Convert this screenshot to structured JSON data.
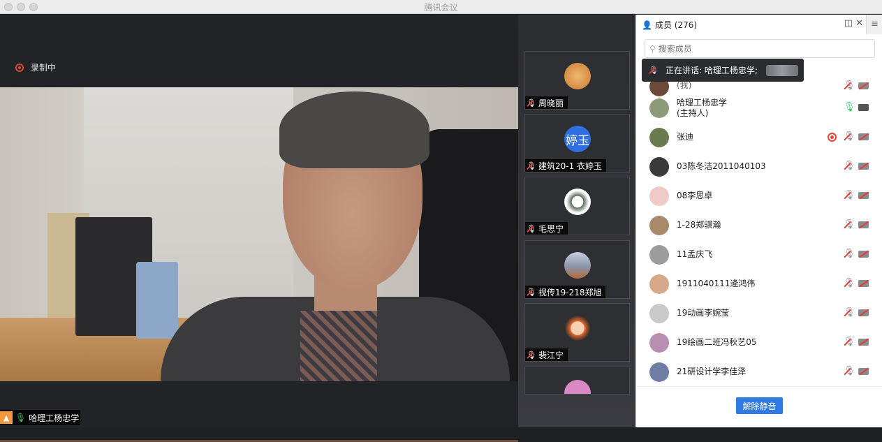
{
  "window": {
    "title": "腾讯会议",
    "traffic_light_color": "#d6d6d6"
  },
  "main": {
    "recording_label": "录制中",
    "recording_color": "#e0473a",
    "self_name": "哈理工杨忠学"
  },
  "thumbnails": [
    {
      "name": "周晓丽",
      "avatar_icon": "dog-avatar-icon",
      "avatar_color": "#d9903f"
    },
    {
      "name": "建筑20-1 衣婷玉",
      "avatar_text": "婷玉",
      "avatar_color": "#2f6fe0"
    },
    {
      "name": "毛思宁",
      "avatar_icon": "cartoon-avatar-icon",
      "avatar_color": "#e8e8e8"
    },
    {
      "name": "视传19-218郑旭",
      "avatar_icon": "landscape-avatar-icon",
      "avatar_color": "#8a94a8"
    },
    {
      "name": "裴江宁",
      "avatar_icon": "cartoon-boy-avatar-icon",
      "avatar_color": "#e2672f"
    }
  ],
  "panel": {
    "title": "成员 (276)",
    "search_placeholder": "搜索成员",
    "tooltip_label": "正在讲话: 哈理工杨忠学;",
    "unmute_button": "解除静音",
    "accent_color": "#2f7ae5",
    "members": [
      {
        "name": "(我)",
        "mic": "off",
        "cam": "off",
        "avatar_color": "#6b4a3a"
      },
      {
        "name": "哈理工杨忠学",
        "sub": "(主持人)",
        "mic": "on",
        "cam": "on",
        "avatar_color": "#8c9a7a"
      },
      {
        "name": "张迪",
        "mic": "off",
        "cam": "off",
        "recording": true,
        "avatar_color": "#6c7a4f"
      },
      {
        "name": "03陈冬洁2011040103",
        "mic": "off",
        "cam": "off",
        "avatar_color": "#3a3a3a"
      },
      {
        "name": "08李思卓",
        "mic": "off",
        "cam": "off",
        "avatar_color": "#f0c9c9"
      },
      {
        "name": "1-28郑骐瀚",
        "mic": "off",
        "cam": "off",
        "avatar_color": "#a88a6a"
      },
      {
        "name": "11孟庆飞",
        "mic": "off",
        "cam": "off",
        "avatar_color": "#9c9c9c"
      },
      {
        "name": "1911040111逄鸿伟",
        "mic": "off",
        "cam": "off",
        "avatar_color": "#d7a98a"
      },
      {
        "name": "19动画李婉莹",
        "mic": "off",
        "cam": "off",
        "avatar_color": "#c9c9c9"
      },
      {
        "name": "19绘画二班冯秋艺05",
        "mic": "off",
        "cam": "off",
        "avatar_color": "#b88fb0"
      },
      {
        "name": "21研设计学李佳泽",
        "mic": "off",
        "cam": "off",
        "avatar_color": "#6f7fa3"
      }
    ]
  }
}
